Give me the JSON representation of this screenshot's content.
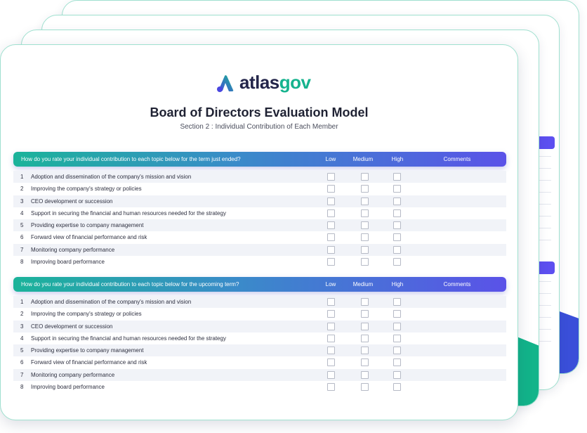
{
  "brand": {
    "name_part1": "atlas",
    "name_part2": "gov",
    "accent": "#16b38e",
    "dark": "#23254a"
  },
  "title": "Board of Directors Evaluation Model",
  "subtitle": "Section 2 : Individual Contribution of Each Member",
  "columns": {
    "low": "Low",
    "medium": "Medium",
    "high": "High",
    "comments": "Comments"
  },
  "sections": [
    {
      "question": "How do you rate your individual contribution to each topic below for the term just ended?",
      "rows": [
        {
          "num": "1",
          "text": "Adoption and dissemination of the company's mission and vision"
        },
        {
          "num": "2",
          "text": "Improving the company's strategy or policies"
        },
        {
          "num": "3",
          "text": "CEO development or succession"
        },
        {
          "num": "4",
          "text": "Support in securing the financial and human resources needed for the strategy"
        },
        {
          "num": "5",
          "text": "Providing expertise to company management"
        },
        {
          "num": "6",
          "text": "Forward view of financial performance and risk"
        },
        {
          "num": "7",
          "text": "Monitoring company performance"
        },
        {
          "num": "8",
          "text": "Improving board performance"
        }
      ]
    },
    {
      "question": "How do you rate your individual contribution to each topic below for the upcoming term?",
      "rows": [
        {
          "num": "1",
          "text": "Adoption and dissemination of the company's mission and vision"
        },
        {
          "num": "2",
          "text": "Improving the company's strategy or policies"
        },
        {
          "num": "3",
          "text": "CEO development or succession"
        },
        {
          "num": "4",
          "text": "Support in securing the financial and human resources needed for the strategy"
        },
        {
          "num": "5",
          "text": "Providing expertise to company management"
        },
        {
          "num": "6",
          "text": "Forward view of financial performance and risk"
        },
        {
          "num": "7",
          "text": "Monitoring company performance"
        },
        {
          "num": "8",
          "text": "Improving board performance"
        }
      ]
    }
  ]
}
